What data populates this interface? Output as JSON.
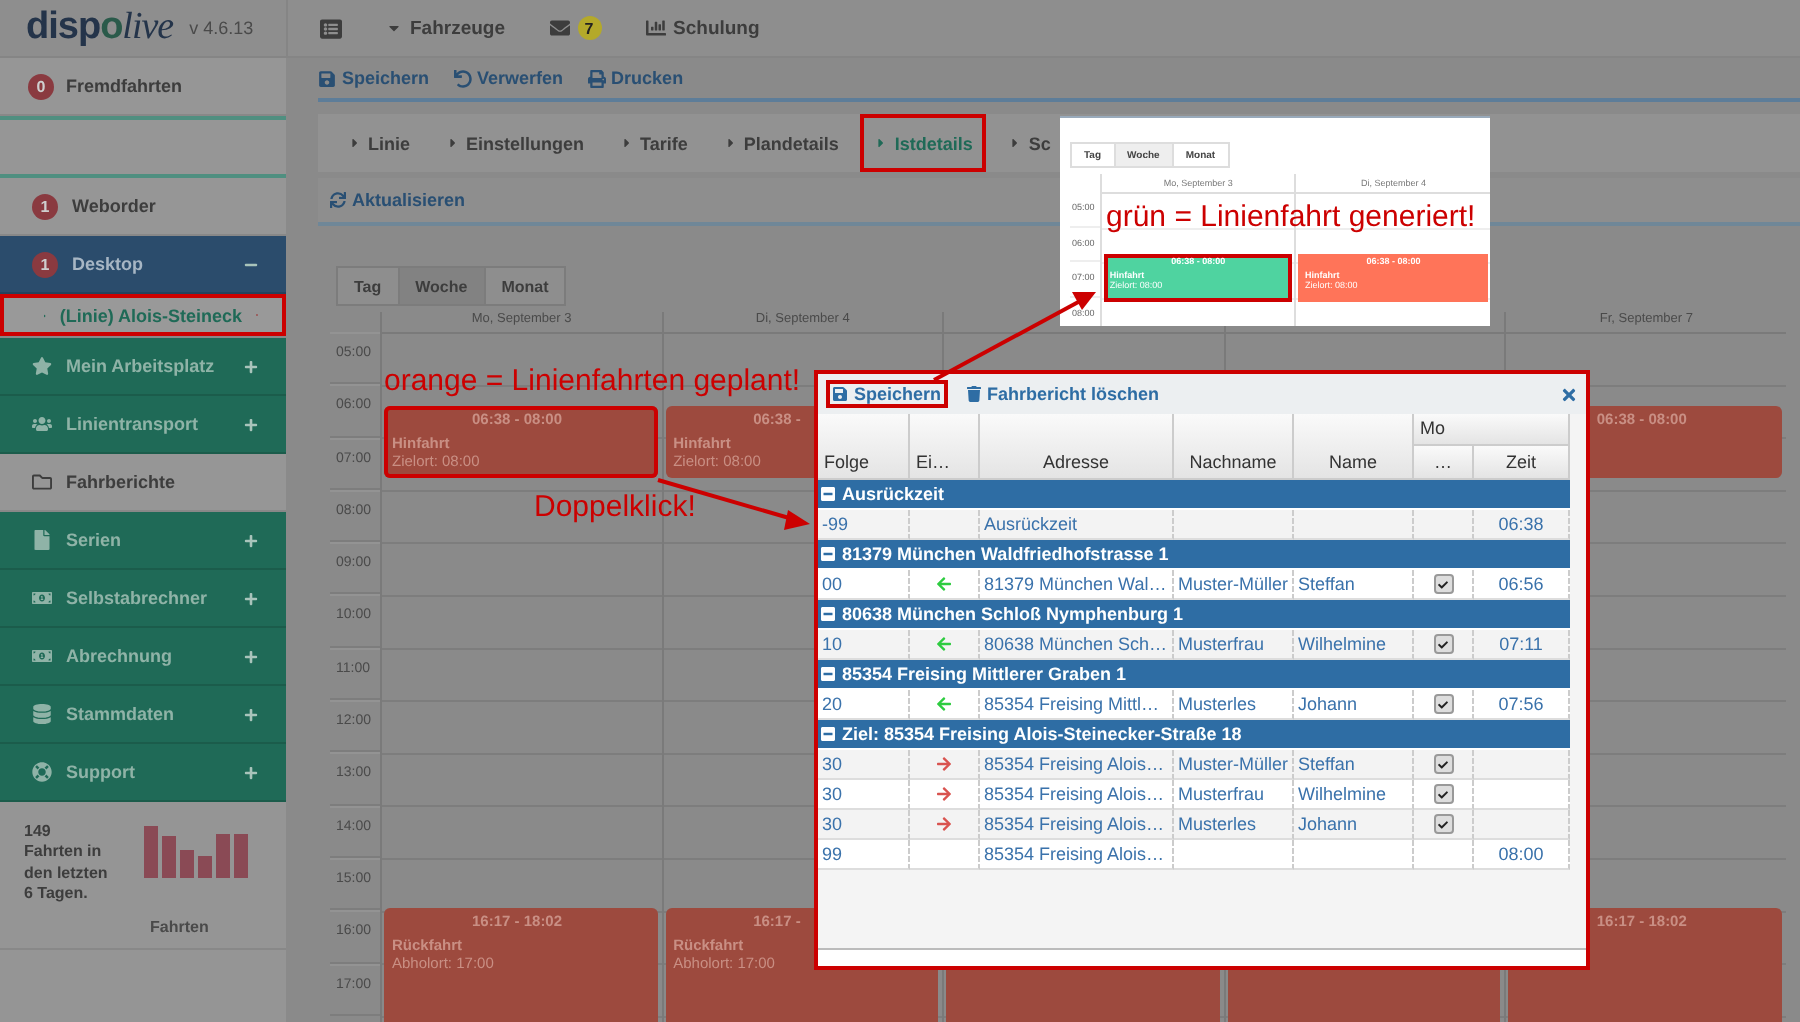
{
  "logo": [
    "disp",
    "o",
    "live"
  ],
  "version": "v 4.6.13",
  "topbar": {
    "vehicles": "Fahrzeuge",
    "mail_count": "7",
    "training": "Schulung"
  },
  "sidebar": {
    "notices": [
      {
        "label": "Fremdfahrten",
        "count": "0"
      }
    ],
    "items": [
      {
        "kind": "badge",
        "label": "Weborder",
        "count": "1"
      },
      {
        "kind": "section",
        "label": "Desktop",
        "count": "1",
        "expanded": true
      },
      {
        "kind": "subitem",
        "label": "(Linie) Alois-Steineck",
        "highlighted": true
      },
      {
        "kind": "module",
        "label": "Mein Arbeitsplatz",
        "expanded": false
      },
      {
        "kind": "module",
        "label": "Linientransport",
        "expanded": false
      },
      {
        "kind": "link",
        "label": "Fahrberichte"
      },
      {
        "kind": "module",
        "label": "Serien",
        "expanded": false
      },
      {
        "kind": "module",
        "label": "Selbstabrechner",
        "expanded": false
      },
      {
        "kind": "module",
        "label": "Abrechnung",
        "expanded": false
      },
      {
        "kind": "module",
        "label": "Stammdaten",
        "expanded": false
      },
      {
        "kind": "module",
        "label": "Support",
        "expanded": false
      }
    ],
    "stats": {
      "summary": [
        "149",
        "Fahrten in",
        "den letzten",
        "6 Tagen."
      ],
      "caption": "Fahrten"
    }
  },
  "actions": [
    "Speichern",
    "Verwerfen",
    "Drucken"
  ],
  "tabs": [
    {
      "label": "Linie",
      "selected": false
    },
    {
      "label": "Einstellungen",
      "selected": false
    },
    {
      "label": "Tarife",
      "selected": false
    },
    {
      "label": "Plandetails",
      "selected": false
    },
    {
      "label": "Istdetails",
      "selected": true,
      "highlighted": true
    },
    {
      "label": "Sc",
      "selected": false
    }
  ],
  "calendar": {
    "refresh": "Aktualisieren",
    "views": [
      {
        "label": "Tag",
        "selected": false
      },
      {
        "label": "Woche",
        "selected": true
      },
      {
        "label": "Monat",
        "selected": false
      }
    ],
    "hours": [
      "05:00",
      "06:00",
      "07:00",
      "08:00",
      "09:00",
      "10:00",
      "11:00",
      "12:00",
      "13:00",
      "14:00",
      "15:00",
      "16:00",
      "17:00"
    ],
    "days": [
      {
        "label": "Mo, September 3",
        "events": [
          {
            "kind": "outbound",
            "time": "06:38 - 08:00",
            "title": "Hinfahrt",
            "detail": "Zielort: 08:00",
            "highlighted": true
          },
          {
            "kind": "return",
            "time": "16:17 - 18:02",
            "title": "Rückfahrt",
            "detail": "Abholort: 17:00"
          }
        ]
      },
      {
        "label": "Di, September 4",
        "events": [
          {
            "kind": "outbound",
            "time": "06:38 -",
            "title": "Hinfahrt",
            "detail": "Zielort: 08:00"
          },
          {
            "kind": "return",
            "time": "16:17 -",
            "title": "Rückfahrt",
            "detail": "Abholort: 17:00"
          }
        ]
      },
      {
        "events": [
          {
            "kind": "return"
          }
        ]
      },
      {
        "events": [
          {
            "kind": "return"
          }
        ]
      },
      {
        "label": "Fr, September 7",
        "events": [
          {
            "kind": "outbound",
            "time": "06:38 - 08:00"
          },
          {
            "kind": "return",
            "time": "16:17 - 18:02"
          }
        ]
      }
    ]
  },
  "dialog": {
    "toolbar": [
      {
        "label": "Speichern",
        "kind": "save",
        "highlighted": true
      },
      {
        "label": "Fahrbericht löschen",
        "kind": "delete"
      }
    ],
    "columns": [
      "Folge",
      "Ei…",
      "Adresse",
      "Nachname",
      "Name"
    ],
    "day_group": "Mo",
    "day_columns": [
      "…",
      "Zeit"
    ],
    "groups": [
      {
        "title": "Ausrückzeit",
        "expanded": true,
        "rows": [
          {
            "kind": "plain",
            "order": "-99",
            "address": "Ausrückzeit",
            "checked": false,
            "time": "06:38"
          }
        ]
      },
      {
        "title": "81379 München Waldfriedhofstrasse 1",
        "expanded": true,
        "rows": [
          {
            "kind": "pickup",
            "order": "00",
            "address": "81379 München Wal…",
            "lastname": "Muster-Müller",
            "name": "Steffan",
            "checked": true,
            "time": "06:56"
          }
        ]
      },
      {
        "title": "80638 München Schloß Nymphenburg 1",
        "expanded": true,
        "rows": [
          {
            "kind": "pickup",
            "order": "10",
            "address": "80638 München Sch…",
            "lastname": "Musterfrau",
            "name": "Wilhelmine",
            "checked": true,
            "time": "07:11"
          }
        ]
      },
      {
        "title": "85354 Freising Mittlerer Graben 1",
        "expanded": true,
        "rows": [
          {
            "kind": "pickup",
            "order": "20",
            "address": "85354 Freising Mittl…",
            "lastname": "Musterles",
            "name": "Johann",
            "checked": true,
            "time": "07:56"
          }
        ]
      },
      {
        "title": "Ziel: 85354 Freising Alois-Steinecker-Straße 18",
        "expanded": true,
        "rows": [
          {
            "kind": "dropoff",
            "order": "30",
            "address": "85354 Freising Alois…",
            "lastname": "Muster-Müller",
            "name": "Steffan",
            "checked": true
          },
          {
            "kind": "dropoff",
            "order": "30",
            "address": "85354 Freising Alois…",
            "lastname": "Musterfrau",
            "name": "Wilhelmine",
            "checked": true
          },
          {
            "kind": "dropoff",
            "order": "30",
            "address": "85354 Freising Alois…",
            "lastname": "Musterles",
            "name": "Johann",
            "checked": true
          },
          {
            "kind": "plain",
            "order": "99",
            "address": "85354 Freising Alois…",
            "checked": false,
            "time": "08:00"
          }
        ]
      }
    ]
  },
  "inset": {
    "views": [
      {
        "label": "Tag",
        "selected": false
      },
      {
        "label": "Woche",
        "selected": true
      },
      {
        "label": "Monat",
        "selected": false
      }
    ],
    "days": [
      "Mo, September 3",
      "Di, September 4"
    ],
    "hours": [
      "05:00",
      "06:00",
      "07:00",
      "08:00"
    ],
    "events": [
      {
        "color": "#4fd3a0",
        "time": "06:38 - 08:00",
        "title": "Hinfahrt",
        "detail": "Zielort: 08:00",
        "highlighted": true
      },
      {
        "color": "#ff7459",
        "time": "06:38 - 08:00",
        "title": "Hinfahrt",
        "detail": "Zielort: 08:00",
        "highlighted": false
      }
    ],
    "note": "grün = Linienfahrt generiert!"
  },
  "notes": [
    "orange = Linienfahrten geplant!",
    "Doppelklick!"
  ]
}
